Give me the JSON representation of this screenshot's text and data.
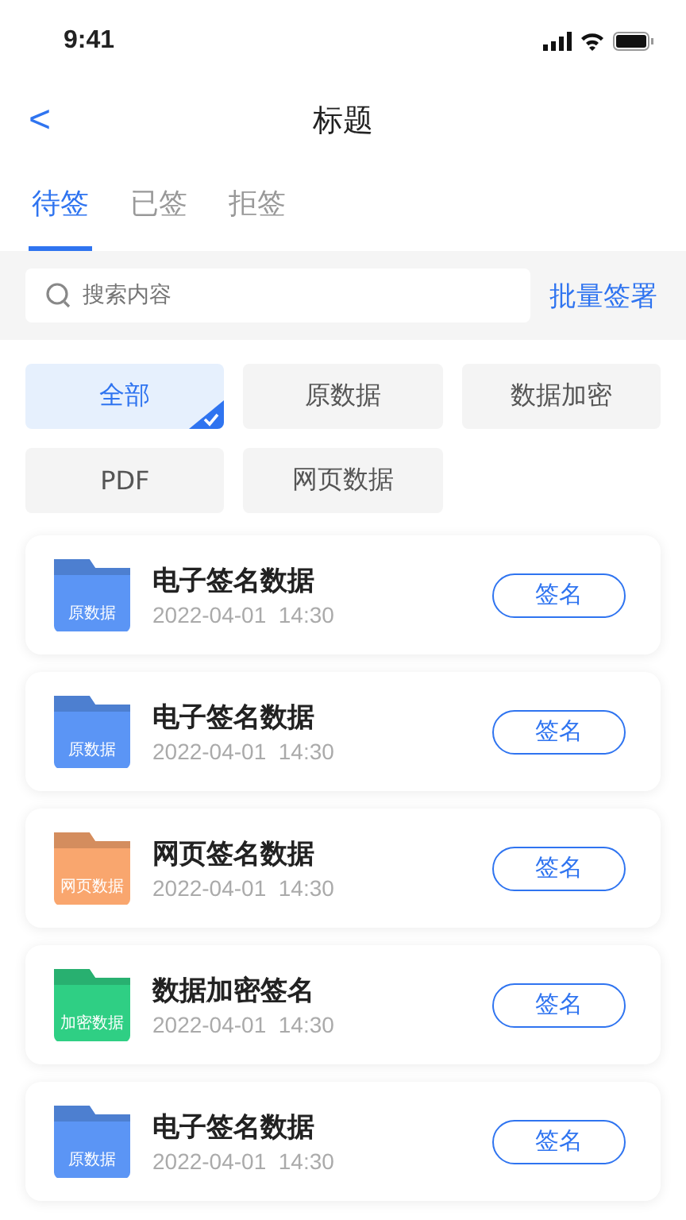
{
  "status_bar": {
    "time": "9:41"
  },
  "nav": {
    "back": "<",
    "title": "标题"
  },
  "tabs": [
    {
      "label": "待签",
      "selected": true
    },
    {
      "label": "已签",
      "selected": false
    },
    {
      "label": "拒签",
      "selected": false
    }
  ],
  "search": {
    "placeholder": "搜索内容",
    "action": "批量签署"
  },
  "filters": [
    {
      "label": "全部",
      "selected": true
    },
    {
      "label": "原数据",
      "selected": false
    },
    {
      "label": "数据加密",
      "selected": false
    },
    {
      "label": "PDF",
      "selected": false
    },
    {
      "label": "网页数据",
      "selected": false
    }
  ],
  "documents": [
    {
      "title": "电子签名数据",
      "date": "2022-04-01  14:30",
      "folder_label": "原数据",
      "color": "#5b95f5",
      "button": "签名"
    },
    {
      "title": "电子签名数据",
      "date": "2022-04-01  14:30",
      "folder_label": "原数据",
      "color": "#5b95f5",
      "button": "签名"
    },
    {
      "title": "网页签名数据",
      "date": "2022-04-01  14:30",
      "folder_label": "网页数据",
      "color": "#f9a66e",
      "button": "签名"
    },
    {
      "title": "数据加密签名",
      "date": "2022-04-01  14:30",
      "folder_label": "加密数据",
      "color": "#2fcf84",
      "button": "签名"
    },
    {
      "title": "电子签名数据",
      "date": "2022-04-01  14:30",
      "folder_label": "原数据",
      "color": "#5b95f5",
      "button": "签名"
    }
  ]
}
